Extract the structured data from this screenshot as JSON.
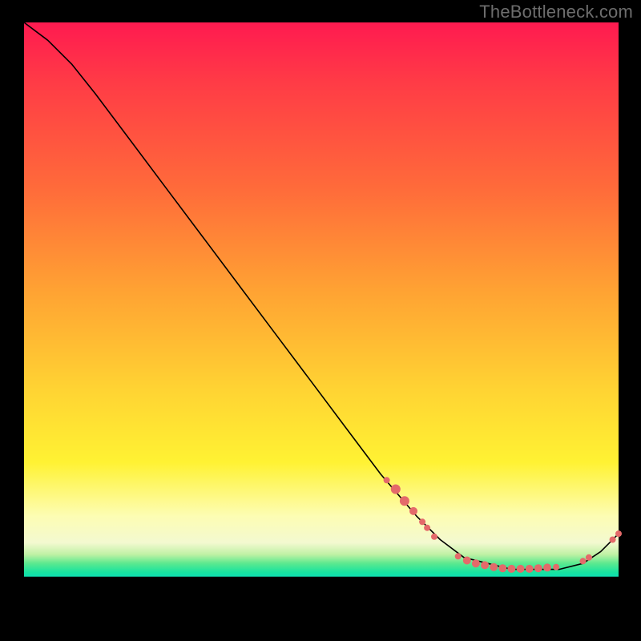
{
  "watermark": "TheBottleneck.com",
  "chart_data": {
    "type": "line",
    "title": "",
    "xlabel": "",
    "ylabel": "",
    "xlim": [
      0,
      100
    ],
    "ylim": [
      0,
      100
    ],
    "grid": false,
    "legend": false,
    "background_gradient": {
      "direction": "vertical",
      "stops": [
        {
          "pos": 0.0,
          "color": "#ff1a50"
        },
        {
          "pos": 0.45,
          "color": "#ffa233"
        },
        {
          "pos": 0.74,
          "color": "#fff233"
        },
        {
          "pos": 0.88,
          "color": "#f3f9d0"
        },
        {
          "pos": 0.92,
          "color": "#17e3a0"
        },
        {
          "pos": 0.93,
          "color": "#000000"
        }
      ]
    },
    "series": [
      {
        "name": "bottleneck-curve",
        "x": [
          0,
          4,
          8,
          12,
          18,
          24,
          30,
          36,
          42,
          48,
          54,
          60,
          66,
          70,
          74,
          78,
          82,
          86,
          90,
          94,
          97,
          100
        ],
        "y": [
          100,
          97,
          93,
          88,
          80,
          72,
          64,
          56,
          48,
          40,
          32,
          24,
          17,
          13,
          10,
          9,
          8,
          8,
          8,
          9,
          11,
          14
        ]
      }
    ],
    "markers": {
      "name": "highlighted-points",
      "color": "#e46a6a",
      "points": [
        {
          "x": 61,
          "y": 23,
          "r": 4
        },
        {
          "x": 62.5,
          "y": 21.5,
          "r": 6
        },
        {
          "x": 64,
          "y": 19.5,
          "r": 6
        },
        {
          "x": 65.5,
          "y": 17.8,
          "r": 5
        },
        {
          "x": 67,
          "y": 16,
          "r": 4
        },
        {
          "x": 67.8,
          "y": 15,
          "r": 4
        },
        {
          "x": 69,
          "y": 13.5,
          "r": 4
        },
        {
          "x": 73,
          "y": 10.2,
          "r": 4
        },
        {
          "x": 74.5,
          "y": 9.5,
          "r": 5
        },
        {
          "x": 76,
          "y": 9,
          "r": 5
        },
        {
          "x": 77.5,
          "y": 8.7,
          "r": 5
        },
        {
          "x": 79,
          "y": 8.4,
          "r": 5
        },
        {
          "x": 80.5,
          "y": 8.2,
          "r": 5
        },
        {
          "x": 82,
          "y": 8.1,
          "r": 5
        },
        {
          "x": 83.5,
          "y": 8.1,
          "r": 5
        },
        {
          "x": 85,
          "y": 8.1,
          "r": 5
        },
        {
          "x": 86.5,
          "y": 8.2,
          "r": 5
        },
        {
          "x": 88,
          "y": 8.3,
          "r": 5
        },
        {
          "x": 89.5,
          "y": 8.4,
          "r": 4
        },
        {
          "x": 94,
          "y": 9.4,
          "r": 4
        },
        {
          "x": 95,
          "y": 10,
          "r": 4
        },
        {
          "x": 99,
          "y": 13,
          "r": 4
        },
        {
          "x": 100,
          "y": 14,
          "r": 4
        }
      ]
    }
  }
}
